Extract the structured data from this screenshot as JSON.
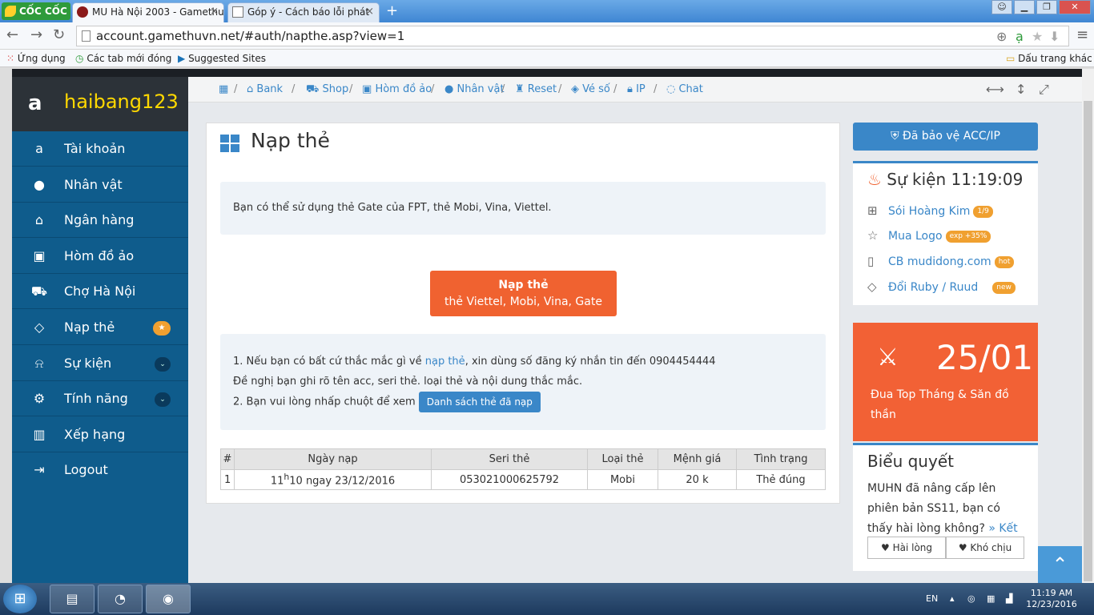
{
  "browser": {
    "logo_text": "CỐC CỐC",
    "tabs": [
      {
        "title": "MU Hà Nội 2003 - Gamethu"
      },
      {
        "title": "Góp ý - Cách báo lỗi phát"
      }
    ],
    "new_tab": "+",
    "url": "account.gamethuvn.net/#auth/napthe.asp?view=1",
    "bookmarks": {
      "apps": "Ứng dụng",
      "new_tabs": "Các tab mới đóng",
      "suggested": "Suggested Sites",
      "other": "Dấu trang khác"
    }
  },
  "sidebar": {
    "username": "haibang123",
    "items": [
      {
        "label": "Tài khoản",
        "icon": "amazon-icon"
      },
      {
        "label": "Nhân vật",
        "icon": "user-icon"
      },
      {
        "label": "Ngân hàng",
        "icon": "bank-icon"
      },
      {
        "label": "Hòm đồ ảo",
        "icon": "briefcase-icon"
      },
      {
        "label": "Chợ Hà Nội",
        "icon": "cart-icon"
      },
      {
        "label": "Nạp thẻ",
        "icon": "diamond-icon",
        "badge": "★"
      },
      {
        "label": "Sự kiện",
        "icon": "android-icon",
        "chevron": "⌄"
      },
      {
        "label": "Tính năng",
        "icon": "cogs-icon",
        "chevron": "⌄"
      },
      {
        "label": "Xếp hạng",
        "icon": "bar-chart-icon"
      },
      {
        "label": "Logout",
        "icon": "sign-out-icon"
      }
    ]
  },
  "breadcrumb": {
    "items": [
      "Bank",
      "Shop",
      "Hòm đồ ảo",
      "Nhân vật",
      "Reset",
      "Vé số",
      "IP",
      "Chat"
    ]
  },
  "main": {
    "title": "Nạp thẻ",
    "info": "Bạn có thể sử dụng thẻ Gate của FPT, thẻ Mobi, Vina, Viettel.",
    "button_title": "Nạp thẻ",
    "button_sub": "thẻ Viettel, Mobi, Vina, Gate",
    "note1_pre": "1. Nếu bạn có bất cứ thắc mắc gì về",
    "note1_link": "nạp thẻ",
    "note1_post": ", xin dùng số đăng ký nhắn tin đến 0904454444",
    "note2": "Đề nghị bạn ghi rõ tên acc, seri thẻ. loại thẻ và nội dung thắc mắc.",
    "note3": "2. Bạn vui lòng nhấp chuột để xem",
    "list_button": "Danh sách thẻ đã nạp",
    "table": {
      "headers": [
        "#",
        "Ngày nạp",
        "Seri thẻ",
        "Loại thẻ",
        "Mệnh giá",
        "Tình trạng"
      ],
      "row": {
        "no": "1",
        "date_hour": "11",
        "date_sup": "h",
        "date_rest": "10 ngay 23/12/2016",
        "serial": "053021000625792",
        "type": "Mobi",
        "value": "20 k",
        "status": "Thẻ đúng"
      }
    }
  },
  "right": {
    "protect_button": "Đã bảo vệ ACC/IP",
    "events_title": "Sự kiện 11:19:09",
    "events": [
      {
        "label": "Sói Hoàng Kim",
        "badge": "1/9"
      },
      {
        "label": "Mua Logo",
        "badge": "exp +35%"
      },
      {
        "label": "CB mudidong.com",
        "badge": "hot"
      },
      {
        "label": "Đổi Ruby / Ruud",
        "badge": "new"
      }
    ],
    "promo_date": "25/01",
    "promo_text": "Đua Top Tháng & Săn đồ thần",
    "poll_title": "Biểu quyết",
    "poll_question": "MUHN đã nâng cấp lên phiên bản SS11, bạn có thấy hài lòng không?",
    "poll_result": "» Kết quả",
    "poll_yes": "Hài lòng",
    "poll_no": "Khó chịu"
  },
  "taskbar": {
    "lang": "EN",
    "time": "11:19 AM",
    "date": "12/23/2016"
  }
}
